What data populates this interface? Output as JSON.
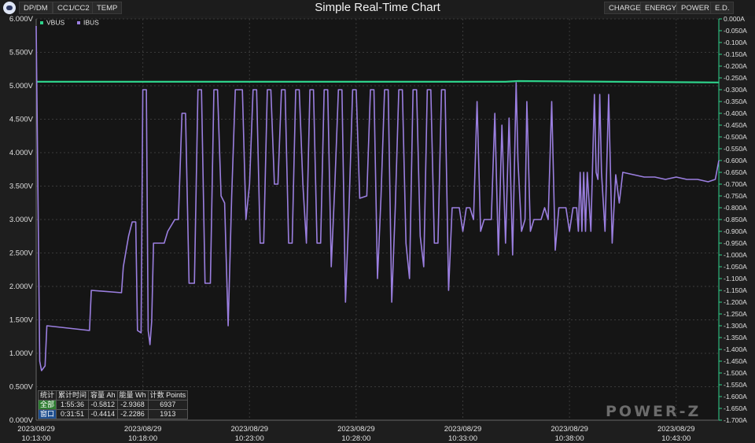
{
  "header": {
    "title": "Simple Real-Time Chart",
    "left_tabs": [
      "DP/DM",
      "CC1/CC2",
      "TEMP"
    ],
    "right_tabs": [
      "CHARGE",
      "ENERGY",
      "POWER",
      "E.D."
    ]
  },
  "stats": {
    "headers": [
      "统计",
      "累计时间",
      "容量 Ah",
      "能量 Wh",
      "计数 Points"
    ],
    "rows": [
      [
        "全部",
        "1:55:36",
        "-0.5812",
        "-2.9368",
        "6937"
      ],
      [
        "窗口",
        "0:31:51",
        "-0.4414",
        "-2.2286",
        "1913"
      ]
    ]
  },
  "watermark": "POWER-Z",
  "colors": {
    "vbus": "#2ed18a",
    "ibus": "#9b7fe0",
    "background": "#1e1e1e",
    "grid": "#3a3a3a"
  },
  "chart_data": {
    "type": "line",
    "legend": [
      "VBUS",
      "IBUS"
    ],
    "legend_placement": "top-left",
    "grid": true,
    "y_left": {
      "unit": "V",
      "ylim": [
        0,
        6
      ],
      "ticks": [
        "0.000V",
        "0.500V",
        "1.000V",
        "1.500V",
        "2.000V",
        "2.500V",
        "3.000V",
        "3.500V",
        "4.000V",
        "4.500V",
        "5.000V",
        "5.500V",
        "6.000V"
      ]
    },
    "y_right": {
      "unit": "A",
      "ylim": [
        0,
        -1.7
      ],
      "ticks": [
        "0.000A",
        "-0.050A",
        "-0.100A",
        "-0.150A",
        "-0.200A",
        "-0.250A",
        "-0.300A",
        "-0.350A",
        "-0.400A",
        "-0.450A",
        "-0.500A",
        "-0.550A",
        "-0.600A",
        "-0.650A",
        "-0.700A",
        "-0.750A",
        "-0.800A",
        "-0.850A",
        "-0.900A",
        "-0.950A",
        "-1.000A",
        "-1.050A",
        "-1.100A",
        "-1.150A",
        "-1.200A",
        "-1.250A",
        "-1.300A",
        "-1.350A",
        "-1.400A",
        "-1.450A",
        "-1.500A",
        "-1.550A",
        "-1.600A",
        "-1.650A",
        "-1.700A"
      ]
    },
    "x": {
      "xlim": [
        "2023/08/29 10:13:00",
        "2023/08/29 10:45:00"
      ],
      "tick_dates": [
        "2023/08/29",
        "2023/08/29",
        "2023/08/29",
        "2023/08/29",
        "2023/08/29",
        "2023/08/29",
        "2023/08/29"
      ],
      "tick_times": [
        "10:13:00",
        "10:18:00",
        "10:23:00",
        "10:28:00",
        "10:33:00",
        "10:38:00",
        "10:43:00"
      ]
    },
    "series": [
      {
        "name": "VBUS",
        "axis": "left",
        "points": [
          [
            "10:13:00",
            5.06
          ],
          [
            "10:20:00",
            5.06
          ],
          [
            "10:30:00",
            5.06
          ],
          [
            "10:35:00",
            5.06
          ],
          [
            "10:35:35",
            5.07
          ],
          [
            "10:40:00",
            5.06
          ],
          [
            "10:45:00",
            5.05
          ]
        ]
      },
      {
        "name": "IBUS",
        "axis": "right",
        "points": [
          [
            "10:13:00",
            -0.03
          ],
          [
            "10:13:10",
            -1.45
          ],
          [
            "10:13:15",
            -1.49
          ],
          [
            "10:13:25",
            -1.47
          ],
          [
            "10:13:30",
            -1.3
          ],
          [
            "10:15:30",
            -1.32
          ],
          [
            "10:15:35",
            -1.15
          ],
          [
            "10:17:00",
            -1.16
          ],
          [
            "10:17:05",
            -1.05
          ],
          [
            "10:17:20",
            -0.92
          ],
          [
            "10:17:30",
            -0.86
          ],
          [
            "10:17:40",
            -0.86
          ],
          [
            "10:17:45",
            -1.32
          ],
          [
            "10:17:55",
            -1.33
          ],
          [
            "10:18:00",
            -0.3
          ],
          [
            "10:18:10",
            -0.3
          ],
          [
            "10:18:15",
            -1.32
          ],
          [
            "10:18:20",
            -1.38
          ],
          [
            "10:18:25",
            -1.28
          ],
          [
            "10:18:30",
            -0.95
          ],
          [
            "10:18:50",
            -0.95
          ],
          [
            "10:19:00",
            -0.95
          ],
          [
            "10:19:10",
            -0.9
          ],
          [
            "10:19:30",
            -0.85
          ],
          [
            "10:19:40",
            -0.85
          ],
          [
            "10:19:50",
            -0.4
          ],
          [
            "10:20:00",
            -0.4
          ],
          [
            "10:20:10",
            -1.12
          ],
          [
            "10:20:25",
            -1.12
          ],
          [
            "10:20:35",
            -0.3
          ],
          [
            "10:20:45",
            -0.3
          ],
          [
            "10:20:55",
            -1.12
          ],
          [
            "10:21:10",
            -1.12
          ],
          [
            "10:21:20",
            -0.3
          ],
          [
            "10:21:30",
            -0.3
          ],
          [
            "10:21:40",
            -0.75
          ],
          [
            "10:21:50",
            -0.78
          ],
          [
            "10:22:00",
            -1.3
          ],
          [
            "10:22:10",
            -0.75
          ],
          [
            "10:22:20",
            -0.3
          ],
          [
            "10:22:40",
            -0.3
          ],
          [
            "10:22:50",
            -0.85
          ],
          [
            "10:23:00",
            -0.7
          ],
          [
            "10:23:10",
            -0.3
          ],
          [
            "10:23:20",
            -0.3
          ],
          [
            "10:23:30",
            -0.95
          ],
          [
            "10:23:40",
            -0.95
          ],
          [
            "10:23:50",
            -0.3
          ],
          [
            "10:24:00",
            -0.3
          ],
          [
            "10:24:10",
            -0.7
          ],
          [
            "10:24:20",
            -0.7
          ],
          [
            "10:24:30",
            -0.3
          ],
          [
            "10:24:40",
            -0.3
          ],
          [
            "10:24:50",
            -0.95
          ],
          [
            "10:25:00",
            -0.95
          ],
          [
            "10:25:10",
            -0.3
          ],
          [
            "10:25:20",
            -0.3
          ],
          [
            "10:25:30",
            -0.7
          ],
          [
            "10:25:40",
            -0.95
          ],
          [
            "10:25:50",
            -0.3
          ],
          [
            "10:26:00",
            -0.3
          ],
          [
            "10:26:10",
            -0.95
          ],
          [
            "10:26:20",
            -0.95
          ],
          [
            "10:26:30",
            -0.3
          ],
          [
            "10:26:40",
            -0.3
          ],
          [
            "10:26:50",
            -1.05
          ],
          [
            "10:27:00",
            -0.7
          ],
          [
            "10:27:10",
            -0.3
          ],
          [
            "10:27:20",
            -0.3
          ],
          [
            "10:27:30",
            -1.2
          ],
          [
            "10:27:40",
            -0.8
          ],
          [
            "10:27:50",
            -0.3
          ],
          [
            "10:28:00",
            -0.3
          ],
          [
            "10:28:10",
            -0.76
          ],
          [
            "10:28:30",
            -0.75
          ],
          [
            "10:28:40",
            -0.3
          ],
          [
            "10:28:50",
            -0.3
          ],
          [
            "10:29:00",
            -1.1
          ],
          [
            "10:29:10",
            -0.75
          ],
          [
            "10:29:20",
            -0.3
          ],
          [
            "10:29:30",
            -0.3
          ],
          [
            "10:29:40",
            -1.2
          ],
          [
            "10:29:50",
            -0.8
          ],
          [
            "10:30:00",
            -0.3
          ],
          [
            "10:30:10",
            -0.3
          ],
          [
            "10:30:20",
            -0.95
          ],
          [
            "10:30:30",
            -1.1
          ],
          [
            "10:30:40",
            -0.3
          ],
          [
            "10:30:50",
            -0.3
          ],
          [
            "10:31:00",
            -0.92
          ],
          [
            "10:31:10",
            -1.05
          ],
          [
            "10:31:20",
            -0.3
          ],
          [
            "10:31:30",
            -0.3
          ],
          [
            "10:31:40",
            -0.95
          ],
          [
            "10:31:50",
            -0.95
          ],
          [
            "10:32:00",
            -0.3
          ],
          [
            "10:32:10",
            -0.3
          ],
          [
            "10:32:20",
            -1.15
          ],
          [
            "10:32:30",
            -0.8
          ],
          [
            "10:32:40",
            -0.8
          ],
          [
            "10:32:50",
            -0.8
          ],
          [
            "10:33:00",
            -0.9
          ],
          [
            "10:33:10",
            -0.8
          ],
          [
            "10:33:20",
            -0.8
          ],
          [
            "10:33:30",
            -0.85
          ],
          [
            "10:33:40",
            -0.35
          ],
          [
            "10:33:50",
            -0.9
          ],
          [
            "10:34:00",
            -0.85
          ],
          [
            "10:34:10",
            -0.85
          ],
          [
            "10:34:20",
            -0.85
          ],
          [
            "10:34:30",
            -0.4
          ],
          [
            "10:34:40",
            -1.0
          ],
          [
            "10:34:50",
            -0.45
          ],
          [
            "10:35:00",
            -0.95
          ],
          [
            "10:35:10",
            -0.42
          ],
          [
            "10:35:20",
            -1.0
          ],
          [
            "10:35:30",
            -0.27
          ],
          [
            "10:35:35",
            -0.6
          ],
          [
            "10:35:45",
            -0.9
          ],
          [
            "10:35:55",
            -0.85
          ],
          [
            "10:36:00",
            -0.35
          ],
          [
            "10:36:10",
            -0.9
          ],
          [
            "10:36:20",
            -0.85
          ],
          [
            "10:36:30",
            -0.85
          ],
          [
            "10:36:40",
            -0.85
          ],
          [
            "10:36:50",
            -0.8
          ],
          [
            "10:37:00",
            -0.85
          ],
          [
            "10:37:10",
            -0.35
          ],
          [
            "10:37:20",
            -0.98
          ],
          [
            "10:37:30",
            -0.8
          ],
          [
            "10:37:50",
            -0.8
          ],
          [
            "10:38:00",
            -0.9
          ],
          [
            "10:38:10",
            -0.8
          ],
          [
            "10:38:20",
            -0.8
          ],
          [
            "10:38:25",
            -0.9
          ],
          [
            "10:38:30",
            -0.65
          ],
          [
            "10:38:35",
            -0.9
          ],
          [
            "10:38:40",
            -0.65
          ],
          [
            "10:38:45",
            -0.9
          ],
          [
            "10:38:50",
            -0.65
          ],
          [
            "10:39:00",
            -0.9
          ],
          [
            "10:39:10",
            -0.32
          ],
          [
            "10:39:15",
            -0.65
          ],
          [
            "10:39:20",
            -0.68
          ],
          [
            "10:39:25",
            -0.32
          ],
          [
            "10:39:30",
            -0.65
          ],
          [
            "10:39:40",
            -0.9
          ],
          [
            "10:39:50",
            -0.32
          ],
          [
            "10:40:00",
            -0.95
          ],
          [
            "10:40:10",
            -0.66
          ],
          [
            "10:40:20",
            -0.78
          ],
          [
            "10:40:30",
            -0.65
          ],
          [
            "10:41:00",
            -0.66
          ],
          [
            "10:41:30",
            -0.67
          ],
          [
            "10:42:00",
            -0.67
          ],
          [
            "10:42:30",
            -0.68
          ],
          [
            "10:43:00",
            -0.67
          ],
          [
            "10:43:30",
            -0.68
          ],
          [
            "10:44:00",
            -0.68
          ],
          [
            "10:44:30",
            -0.69
          ],
          [
            "10:44:50",
            -0.68
          ],
          [
            "10:45:00",
            -0.6
          ]
        ]
      }
    ]
  }
}
